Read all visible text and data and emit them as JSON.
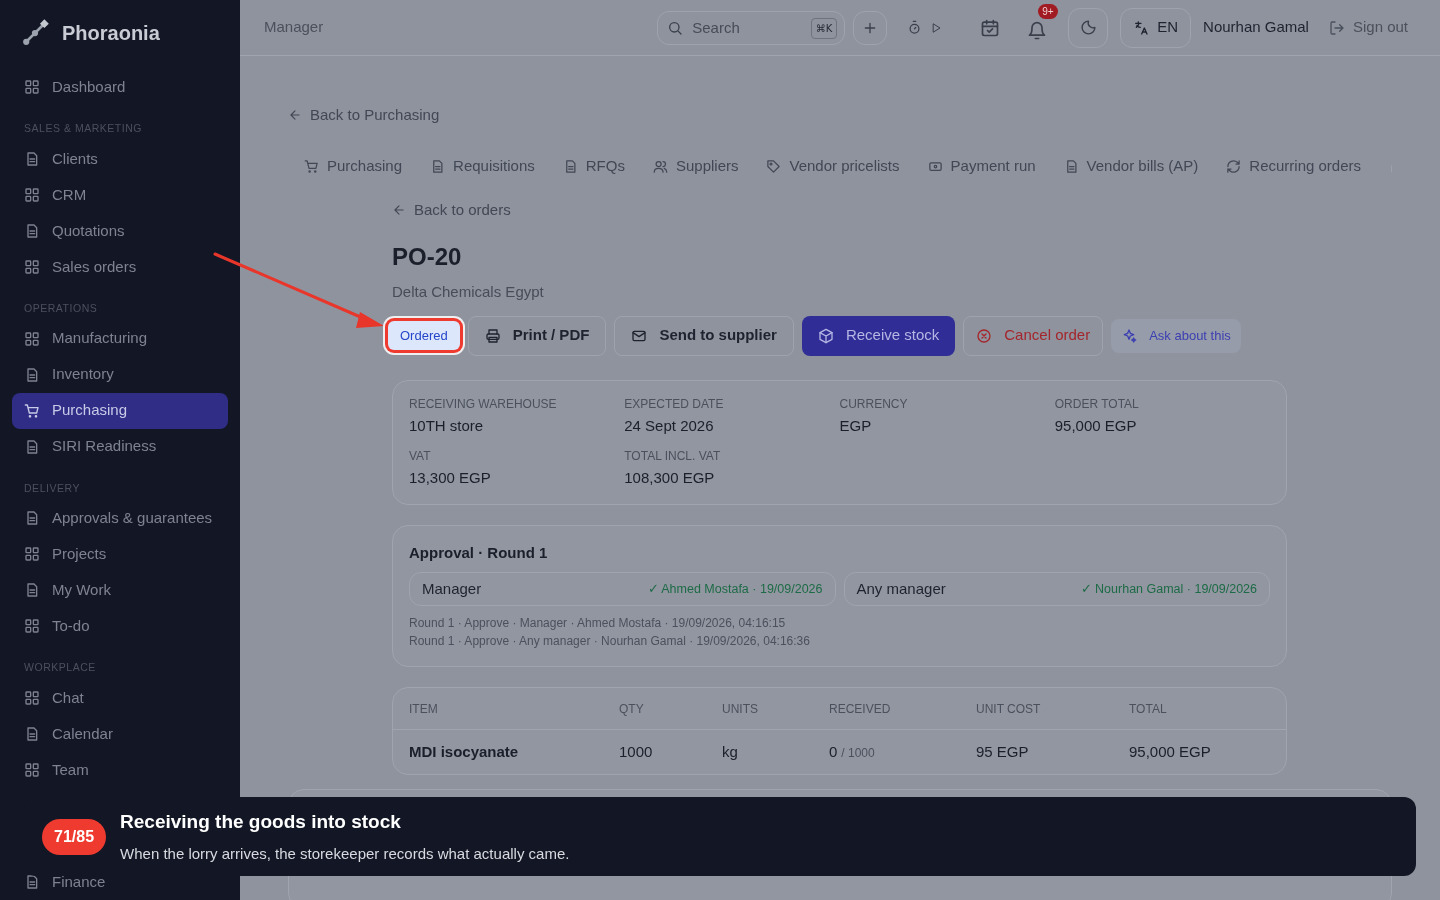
{
  "brand": "Phoraonia",
  "top_bar": {
    "breadcrumb": "Manager",
    "search": {
      "placeholder": "Search",
      "shortcut": "⌘K"
    },
    "notification_count": "9+",
    "language": "EN",
    "user": "Nourhan Gamal",
    "sign_out": "Sign out"
  },
  "sidebar": {
    "sections": [
      {
        "items": [
          {
            "label": "Dashboard",
            "selected": false
          }
        ]
      },
      {
        "heading": "SALES & MARKETING",
        "items": [
          {
            "label": "Clients",
            "selected": false
          },
          {
            "label": "CRM",
            "selected": false
          },
          {
            "label": "Quotations",
            "selected": false
          },
          {
            "label": "Sales orders",
            "selected": false
          }
        ]
      },
      {
        "heading": "OPERATIONS",
        "items": [
          {
            "label": "Manufacturing",
            "selected": false
          },
          {
            "label": "Inventory",
            "selected": false
          },
          {
            "label": "Purchasing",
            "selected": true
          },
          {
            "label": "SIRI Readiness",
            "selected": false
          }
        ]
      },
      {
        "heading": "DELIVERY",
        "items": [
          {
            "label": "Approvals & guarantees",
            "selected": false
          },
          {
            "label": "Projects",
            "selected": false
          },
          {
            "label": "My Work",
            "selected": false
          },
          {
            "label": "To-do",
            "selected": false
          }
        ]
      },
      {
        "heading": "WORKPLACE",
        "items": [
          {
            "label": "Chat",
            "selected": false
          },
          {
            "label": "Calendar",
            "selected": false
          },
          {
            "label": "Team",
            "selected": false
          }
        ]
      },
      {
        "items": [
          {
            "label": "Finance",
            "selected": false
          }
        ]
      }
    ]
  },
  "back_link": "Back to Purchasing",
  "tabs": [
    {
      "label": "Purchasing"
    },
    {
      "label": "Requisitions"
    },
    {
      "label": "RFQs"
    },
    {
      "label": "Suppliers"
    },
    {
      "label": "Vendor pricelists"
    },
    {
      "label": "Payment run"
    },
    {
      "label": "Vendor bills (AP)"
    },
    {
      "label": "Recurring orders"
    }
  ],
  "order": {
    "back_link": "Back to orders",
    "number": "PO-20",
    "supplier": "Delta Chemicals Egypt",
    "status": "Ordered",
    "actions": [
      {
        "label": "Print / PDF",
        "kind": "default"
      },
      {
        "label": "Send to supplier",
        "kind": "default"
      },
      {
        "label": "Receive stock",
        "kind": "primary"
      },
      {
        "label": "Cancel order",
        "kind": "danger"
      },
      {
        "label": "Ask about this",
        "kind": "ai"
      }
    ],
    "summary": [
      {
        "label": "RECEIVING WAREHOUSE",
        "value": "10TH store"
      },
      {
        "label": "EXPECTED DATE",
        "value": "24 Sept 2026"
      },
      {
        "label": "CURRENCY",
        "value": "EGP"
      },
      {
        "label": "ORDER TOTAL",
        "value": "95,000 EGP"
      },
      {
        "label": "VAT",
        "value": "13,300 EGP"
      },
      {
        "label": "TOTAL INCL. VAT",
        "value": "108,300 EGP"
      }
    ],
    "approval": {
      "title": "Approval · Round 1",
      "steps": [
        {
          "role": "Manager",
          "approver": "✓ Ahmed Mostafa · 19/09/2026"
        },
        {
          "role": "Any manager",
          "approver": "✓ Nourhan Gamal · 19/09/2026"
        }
      ],
      "log": [
        "Round 1 · Approve · Manager · Ahmed Mostafa · 19/09/2026, 04:16:15",
        "Round 1 · Approve · Any manager · Nourhan Gamal · 19/09/2026, 04:16:36"
      ]
    },
    "items": {
      "columns": [
        "ITEM",
        "QTY",
        "UNITS",
        "RECEIVED",
        "UNIT COST",
        "TOTAL"
      ],
      "rows": [
        {
          "item": "MDI isocyanate",
          "qty": "1000",
          "units": "kg",
          "received": "0",
          "ordered": "/ 1000",
          "unit_cost": "95 EGP",
          "total": "95,000 EGP"
        }
      ]
    }
  },
  "tour": {
    "step": "71/85",
    "title": "Receiving the goods into stock",
    "text": "When the lorry arrives, the storekeeper records what actually came."
  }
}
